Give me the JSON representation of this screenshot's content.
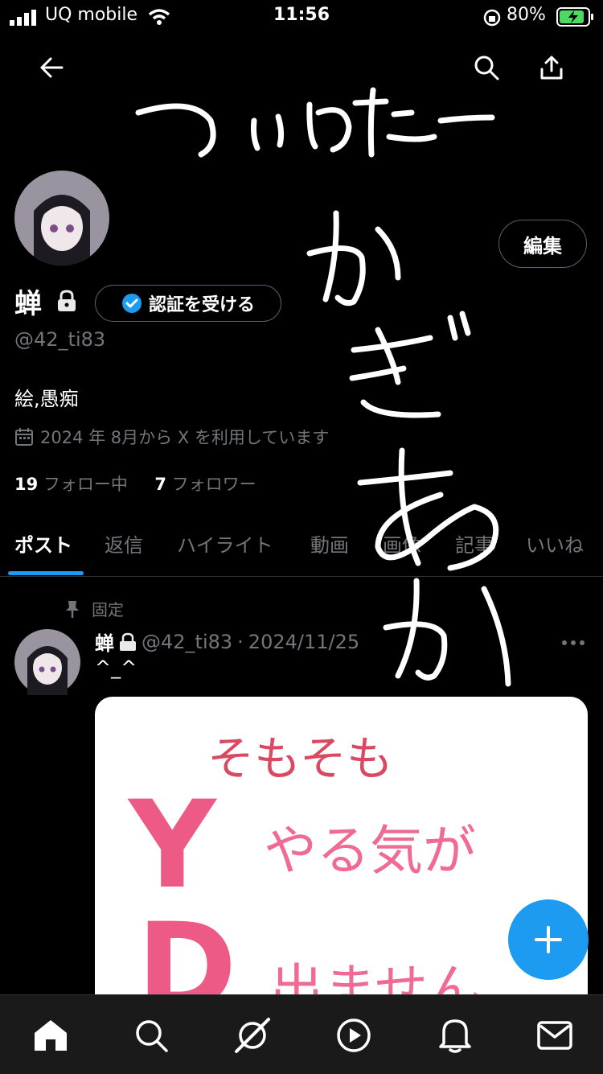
{
  "status_bar": {
    "carrier": "UQ mobile",
    "time": "11:56",
    "battery": "80%"
  },
  "header": {
    "back_icon": "arrow-left-icon",
    "search_icon": "search-icon",
    "share_icon": "share-icon"
  },
  "profile": {
    "edit_label": "編集",
    "name": "蝉",
    "verify_label": "認証を受ける",
    "handle": "@42_ti83",
    "bio": "絵,愚痴",
    "joined": "2024 年 8月から X を利用しています",
    "following_count": "19",
    "following_label": "フォロー中",
    "followers_count": "7",
    "followers_label": "フォロワー"
  },
  "tabs": [
    {
      "label": "ポスト"
    },
    {
      "label": "返信"
    },
    {
      "label": "ハイライト"
    },
    {
      "label": "動画"
    },
    {
      "label": "画像"
    },
    {
      "label": "記事"
    },
    {
      "label": "いいね"
    }
  ],
  "post": {
    "pinned_label": "固定",
    "name": "蝉",
    "handle": "@42_ti83",
    "date": "2024/11/25",
    "text": "^_^",
    "image_text": {
      "line1": "そもそも",
      "letter1": "Y",
      "line2": "やる気が",
      "letter2": "D",
      "line3": "出ません。"
    }
  },
  "handwriting": {
    "line1": "ついったー",
    "line2": "かぎあか"
  },
  "colors": {
    "accent": "#1d9bf0",
    "muted": "#71767b",
    "pink": "#ec5a85"
  }
}
